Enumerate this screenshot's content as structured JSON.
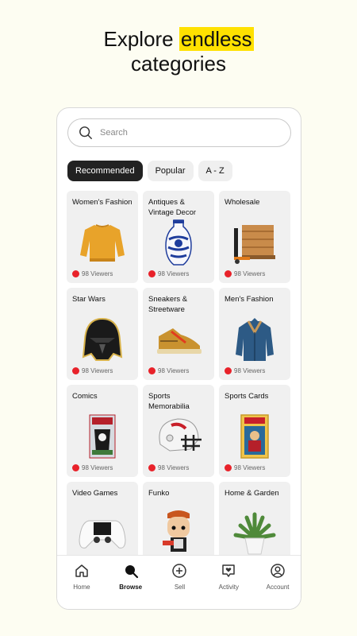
{
  "headline": {
    "line1_prefix": "Explore ",
    "line1_highlight": "endless",
    "line2": "categories"
  },
  "search": {
    "placeholder": "Search"
  },
  "filters": [
    "Recommended",
    "Popular",
    "A - Z"
  ],
  "active_filter": "Recommended",
  "categories": [
    {
      "name": "Women's Fashion",
      "viewers": "98 Viewers",
      "icon": "sweater-icon"
    },
    {
      "name": "Antiques & Vintage Decor",
      "viewers": "98 Viewers",
      "icon": "vase-icon"
    },
    {
      "name": "Wholesale",
      "viewers": "98 Viewers",
      "icon": "pallet-icon"
    },
    {
      "name": "Star Wars",
      "viewers": "98 Viewers",
      "icon": "helmet-pin-icon"
    },
    {
      "name": "Sneakers & Streetware",
      "viewers": "98 Viewers",
      "icon": "sneaker-icon"
    },
    {
      "name": "Men's Fashion",
      "viewers": "98 Viewers",
      "icon": "jacket-icon"
    },
    {
      "name": "Comics",
      "viewers": "98 Viewers",
      "icon": "comic-book-icon"
    },
    {
      "name": "Sports Memorabilia",
      "viewers": "98 Viewers",
      "icon": "football-helmet-icon"
    },
    {
      "name": "Sports Cards",
      "viewers": "98 Viewers",
      "icon": "graded-card-icon"
    },
    {
      "name": "Video Games",
      "viewers": "",
      "icon": "controller-icon"
    },
    {
      "name": "Funko",
      "viewers": "",
      "icon": "figure-icon"
    },
    {
      "name": "Home & Garden",
      "viewers": "",
      "icon": "plant-icon"
    }
  ],
  "tabs": [
    {
      "label": "Home",
      "icon": "home-icon"
    },
    {
      "label": "Browse",
      "icon": "browse-icon"
    },
    {
      "label": "Sell",
      "icon": "plus-circle-icon"
    },
    {
      "label": "Activity",
      "icon": "heart-message-icon"
    },
    {
      "label": "Account",
      "icon": "user-icon"
    }
  ],
  "active_tab": "Browse",
  "colors": {
    "accent": "#ffe100",
    "live": "#e8222a",
    "background": "#fdfdf2"
  }
}
